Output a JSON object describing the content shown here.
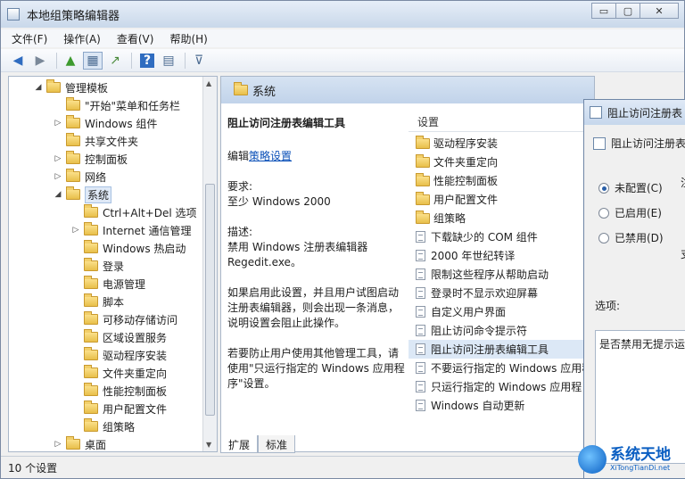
{
  "window": {
    "title": "本地组策略编辑器",
    "btn_min": "▭",
    "btn_max": "▢",
    "btn_close": "✕"
  },
  "menu": [
    "文件(F)",
    "操作(A)",
    "查看(V)",
    "帮助(H)"
  ],
  "toolbar": {
    "back": "◀",
    "forward": "▶",
    "up": "▲",
    "show_tree": "▦",
    "export": "↗",
    "help": "?",
    "properties": "▤",
    "filter": "⊽"
  },
  "tree": [
    {
      "label": "管理模板",
      "level": 0,
      "expanded": true
    },
    {
      "label": "\"开始\"菜单和任务栏",
      "level": 1,
      "arrow": ""
    },
    {
      "label": "Windows 组件",
      "level": 1,
      "arrow": "▷"
    },
    {
      "label": "共享文件夹",
      "level": 1,
      "arrow": ""
    },
    {
      "label": "控制面板",
      "level": 1,
      "arrow": "▷"
    },
    {
      "label": "网络",
      "level": 1,
      "arrow": "▷"
    },
    {
      "label": "系统",
      "level": 1,
      "arrow": "◢",
      "selected": true
    },
    {
      "label": "Ctrl+Alt+Del 选项",
      "level": 2,
      "arrow": ""
    },
    {
      "label": "Internet 通信管理",
      "level": 2,
      "arrow": "▷"
    },
    {
      "label": "Windows 热启动",
      "level": 2,
      "arrow": ""
    },
    {
      "label": "登录",
      "level": 2,
      "arrow": ""
    },
    {
      "label": "电源管理",
      "level": 2,
      "arrow": ""
    },
    {
      "label": "脚本",
      "level": 2,
      "arrow": ""
    },
    {
      "label": "可移动存储访问",
      "level": 2,
      "arrow": ""
    },
    {
      "label": "区域设置服务",
      "level": 2,
      "arrow": ""
    },
    {
      "label": "驱动程序安装",
      "level": 2,
      "arrow": ""
    },
    {
      "label": "文件夹重定向",
      "level": 2,
      "arrow": ""
    },
    {
      "label": "性能控制面板",
      "level": 2,
      "arrow": ""
    },
    {
      "label": "用户配置文件",
      "level": 2,
      "arrow": ""
    },
    {
      "label": "组策略",
      "level": 2,
      "arrow": ""
    },
    {
      "label": "桌面",
      "level": 1,
      "arrow": "▷"
    }
  ],
  "pane": {
    "header": "系统",
    "desc_title": "阻止访问注册表编辑工具",
    "edit_prefix": "编辑",
    "edit_link": "策略设置",
    "req_label": "要求:",
    "req_value": "至少 Windows 2000",
    "desc_label": "描述:",
    "desc_text": "禁用 Windows 注册表编辑器 Regedit.exe。",
    "para1": "如果启用此设置，并且用户试图启动注册表编辑器，则会出现一条消息，说明设置会阻止此操作。",
    "para2": "若要防止用户使用其他管理工具，请使用\"只运行指定的 Windows 应用程序\"设置。"
  },
  "list": {
    "header": "设置",
    "items": [
      {
        "label": "驱动程序安装",
        "kind": "folder"
      },
      {
        "label": "文件夹重定向",
        "kind": "folder"
      },
      {
        "label": "性能控制面板",
        "kind": "folder"
      },
      {
        "label": "用户配置文件",
        "kind": "folder"
      },
      {
        "label": "组策略",
        "kind": "folder"
      },
      {
        "label": "下载缺少的 COM 组件",
        "kind": "policy"
      },
      {
        "label": "2000 年世纪转译",
        "kind": "policy"
      },
      {
        "label": "限制这些程序从帮助启动",
        "kind": "policy"
      },
      {
        "label": "登录时不显示欢迎屏幕",
        "kind": "policy"
      },
      {
        "label": "自定义用户界面",
        "kind": "policy"
      },
      {
        "label": "阻止访问命令提示符",
        "kind": "policy"
      },
      {
        "label": "阻止访问注册表编辑工具",
        "kind": "policy",
        "selected": true
      },
      {
        "label": "不要运行指定的 Windows 应用程",
        "kind": "policy"
      },
      {
        "label": "只运行指定的 Windows 应用程",
        "kind": "policy"
      },
      {
        "label": "Windows 自动更新",
        "kind": "policy"
      }
    ]
  },
  "tabs": [
    "扩展",
    "标准"
  ],
  "status": "10 个设置",
  "dialog": {
    "title": "阻止访问注册表",
    "heading": "阻止访问注册表",
    "radio_not_configured": "未配置(C)",
    "radio_enabled": "已启用(E)",
    "radio_disabled": "已禁用(D)",
    "frag_note": "注",
    "frag_support": "支",
    "options_label": "选项:",
    "options_text": "是否禁用无提示运"
  },
  "watermark": {
    "main": "系统天地",
    "sub": "XiTongTianDi.net"
  }
}
